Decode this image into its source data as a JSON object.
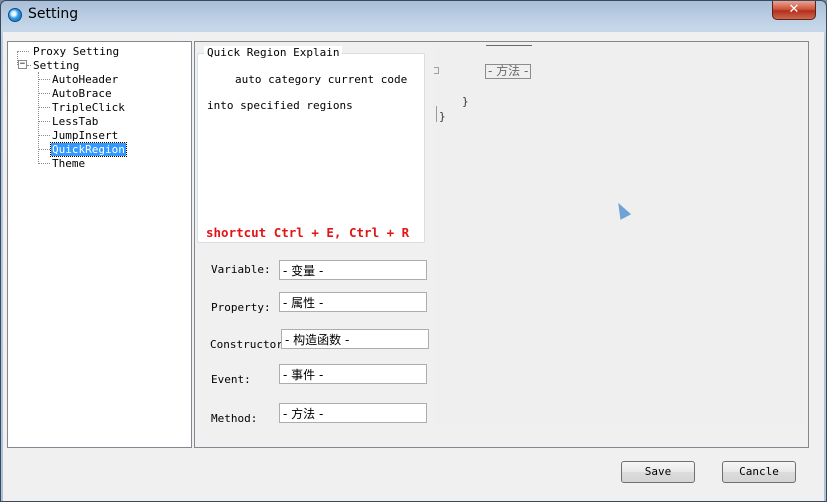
{
  "window": {
    "title": "Setting",
    "close_glyph": "✕"
  },
  "tree": {
    "root1": "Proxy Setting",
    "root2": "Setting",
    "expander_glyph": "−",
    "children": [
      "AutoHeader",
      "AutoBrace",
      "TripleClick",
      "LessTab",
      "JumpInsert",
      "QuickRegion",
      "Theme"
    ],
    "selected": "QuickRegion"
  },
  "explain": {
    "title": "Quick Region Explain",
    "line1": "auto category current code",
    "line2": "into specified regions",
    "shortcut": "shortcut Ctrl + E, Ctrl + R",
    "shortcut_color": "#e01515"
  },
  "fields": [
    {
      "label": "Variable:",
      "value": "- 变量 -"
    },
    {
      "label": "Property:",
      "value": "- 属性 -"
    },
    {
      "label": "Constructor:",
      "value": "- 构造函数 -"
    },
    {
      "label": "Event:",
      "value": "- 事件 -"
    },
    {
      "label": "Method:",
      "value": "- 方法 -"
    }
  ],
  "preview": {
    "region_label": "- 方法 -",
    "inner_brace": "}",
    "outer_brace": "}",
    "cursor_icon": "pointer-cursor-icon"
  },
  "buttons": {
    "save": "Save",
    "cancel": "Cancle"
  }
}
